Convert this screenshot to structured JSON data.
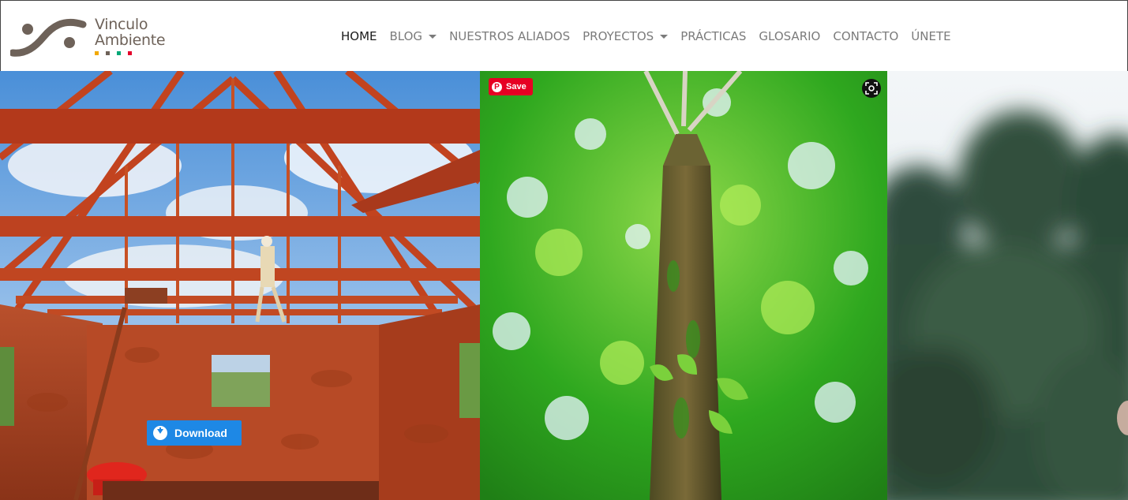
{
  "brand": {
    "line1": "Vinculo",
    "line2": "Ambiente",
    "logo_icon": "vinculo-ambiente-swirl-logo",
    "text_color": "#6e6259",
    "dot_colors": [
      "#f2a900",
      "#6e6259",
      "#00a878",
      "#e4002b"
    ]
  },
  "nav": {
    "items": [
      {
        "label": "HOME",
        "active": true,
        "dropdown": false
      },
      {
        "label": "BLOG",
        "active": false,
        "dropdown": true
      },
      {
        "label": "NUESTROS ALIADOS",
        "active": false,
        "dropdown": false
      },
      {
        "label": "PROYECTOS",
        "active": false,
        "dropdown": true
      },
      {
        "label": "PRÁCTICAS",
        "active": false,
        "dropdown": false
      },
      {
        "label": "GLOSARIO",
        "active": false,
        "dropdown": false
      },
      {
        "label": "CONTACTO",
        "active": false,
        "dropdown": false
      },
      {
        "label": "ÚNETE",
        "active": false,
        "dropdown": false
      }
    ]
  },
  "gallery": {
    "photos": [
      {
        "subject": "adobe-house-roof-construction"
      },
      {
        "subject": "tall-tree-canopy"
      },
      {
        "subject": "blurred-forest"
      }
    ],
    "download_label": "Download",
    "download_icon": "download-circle-icon",
    "save_label": "Save",
    "save_icon": "pinterest-icon",
    "lens_icon": "visual-search-icon",
    "colors": {
      "download_bg": "#1e88e5",
      "save_bg": "#e60023"
    }
  }
}
